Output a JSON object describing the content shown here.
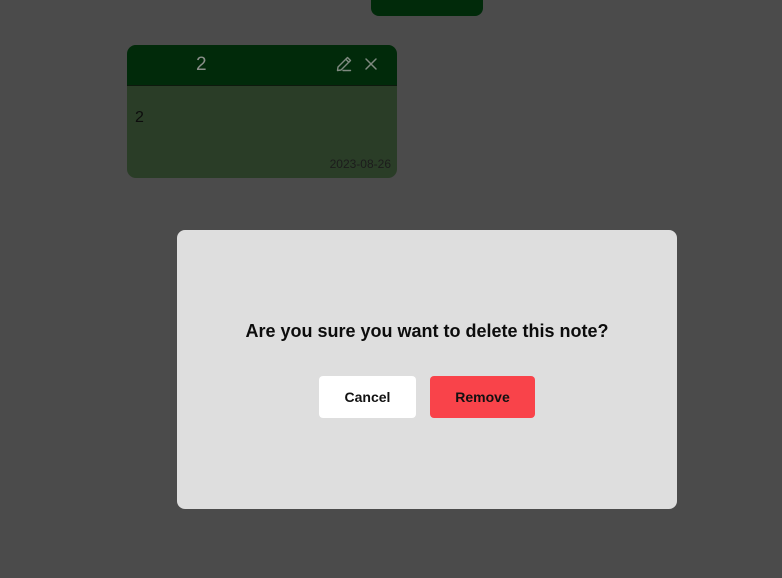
{
  "note": {
    "title": "2",
    "body": "2",
    "date": "2023-08-26",
    "icons": {
      "edit": "pencil-icon",
      "close": "close-icon"
    },
    "colors": {
      "header": "#012a0a",
      "body": "#2a3d27"
    }
  },
  "modal": {
    "question": "Are you sure you want to delete this note?",
    "cancel_label": "Cancel",
    "remove_label": "Remove",
    "colors": {
      "background": "#dedede",
      "remove": "#f9434a",
      "cancel": "#ffffff"
    }
  },
  "page": {
    "background": "#4b4b4b"
  }
}
